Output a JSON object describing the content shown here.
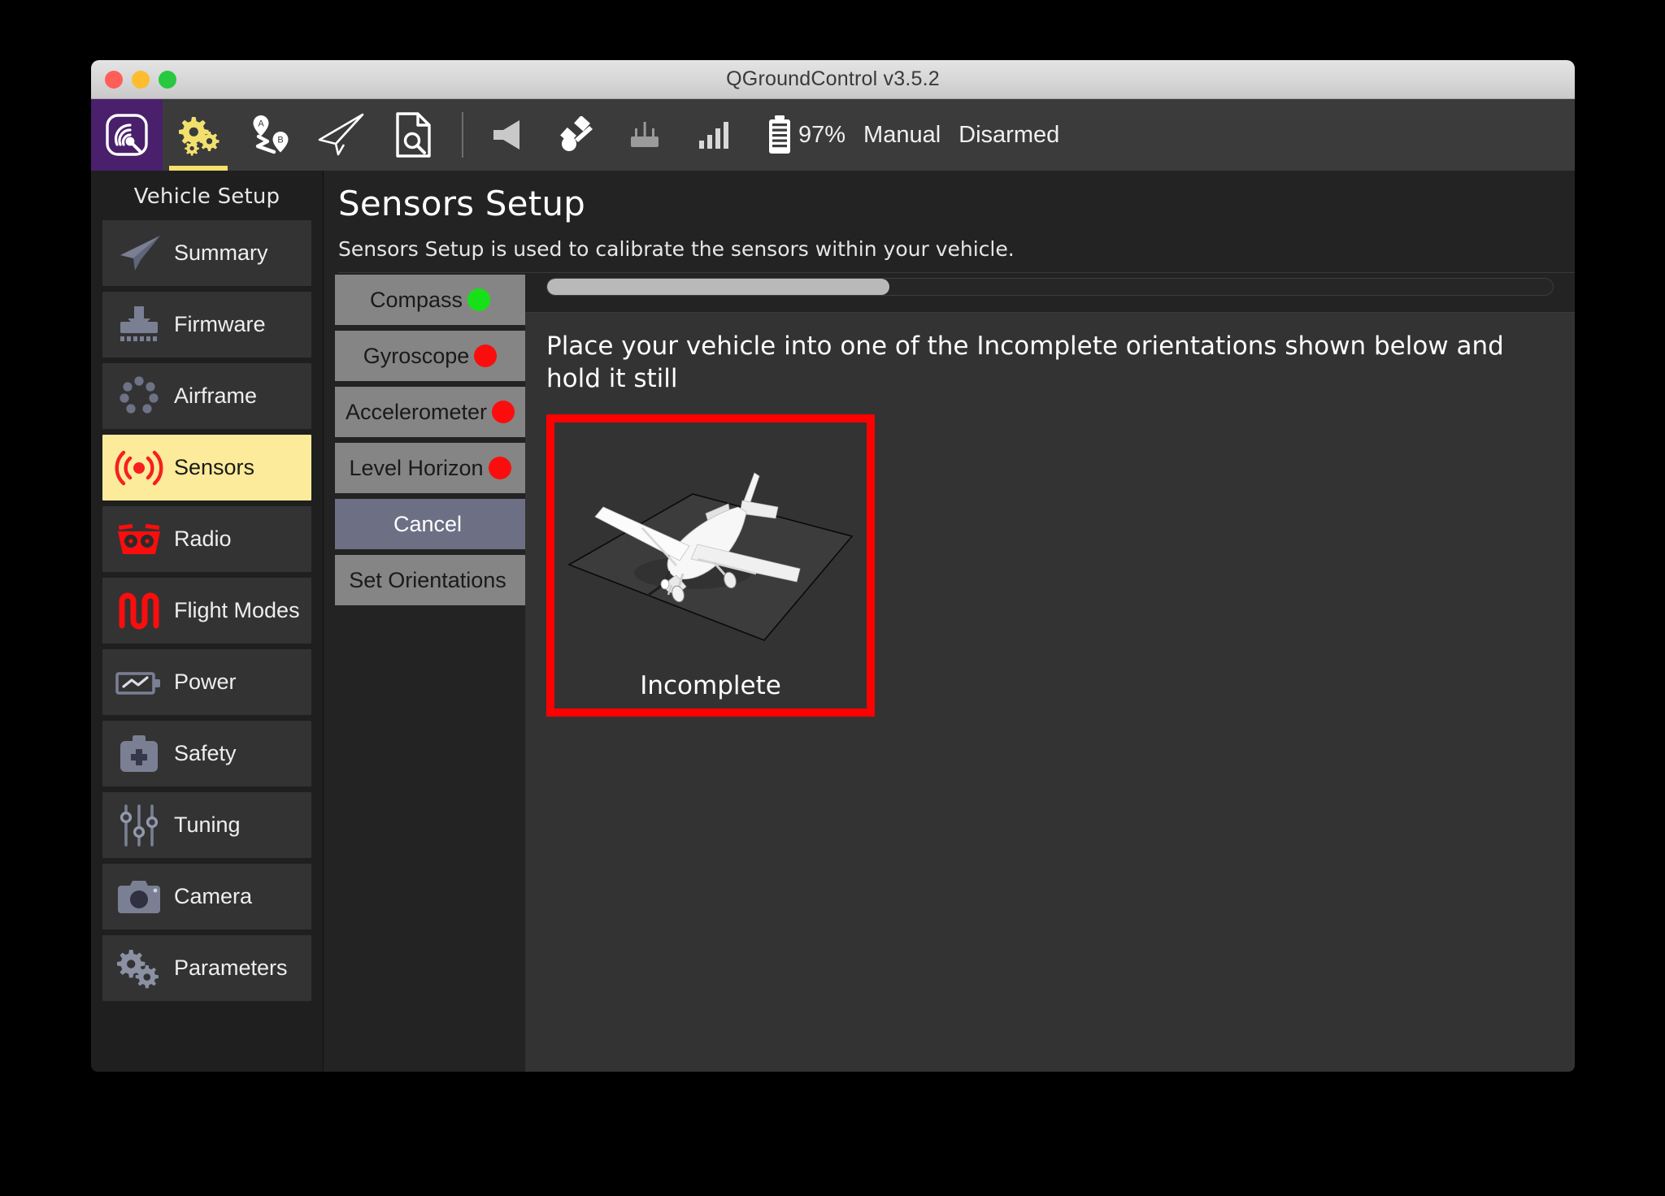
{
  "window": {
    "title": "QGroundControl v3.5.2",
    "traffic_lights": [
      "close",
      "minimize",
      "zoom"
    ]
  },
  "toolbar": {
    "app_button_icon": "qgc-logo-icon",
    "tabs": [
      {
        "icon": "gears-icon",
        "name": "vehicle-setup",
        "active": true
      },
      {
        "icon": "plan-route-icon",
        "name": "plan",
        "active": false
      },
      {
        "icon": "paper-plane-icon",
        "name": "fly",
        "active": false
      },
      {
        "icon": "analyze-file-icon",
        "name": "analyze",
        "active": false
      }
    ],
    "indicators": [
      {
        "icon": "megaphone-icon",
        "name": "messages-indicator"
      },
      {
        "icon": "satellite-icon",
        "name": "gps-indicator"
      },
      {
        "icon": "rc-controller-icon",
        "name": "rc-indicator"
      },
      {
        "icon": "signal-bars-icon",
        "name": "telemetry-indicator"
      }
    ],
    "battery_icon": "battery-icon",
    "battery_percent": "97%",
    "flight_mode": "Manual",
    "armed_state": "Disarmed"
  },
  "sidebar": {
    "title": "Vehicle Setup",
    "items": [
      {
        "label": "Summary",
        "icon": "paper-plane-icon",
        "selected": false
      },
      {
        "label": "Firmware",
        "icon": "firmware-download-icon",
        "selected": false
      },
      {
        "label": "Airframe",
        "icon": "airframe-dots-icon",
        "selected": false
      },
      {
        "label": "Sensors",
        "icon": "sensors-waves-icon",
        "selected": true
      },
      {
        "label": "Radio",
        "icon": "radio-controller-icon",
        "selected": false
      },
      {
        "label": "Flight Modes",
        "icon": "flight-modes-icon",
        "selected": false
      },
      {
        "label": "Power",
        "icon": "power-battery-icon",
        "selected": false
      },
      {
        "label": "Safety",
        "icon": "safety-kit-icon",
        "selected": false
      },
      {
        "label": "Tuning",
        "icon": "tuning-sliders-icon",
        "selected": false
      },
      {
        "label": "Camera",
        "icon": "camera-icon",
        "selected": false
      },
      {
        "label": "Parameters",
        "icon": "parameters-gears-icon",
        "selected": false
      }
    ]
  },
  "page": {
    "title": "Sensors Setup",
    "subtitle": "Sensors Setup is used to calibrate the sensors within your vehicle."
  },
  "calibration": {
    "buttons": [
      {
        "label": "Compass",
        "status": "ok",
        "type": "sensor"
      },
      {
        "label": "Gyroscope",
        "status": "bad",
        "type": "sensor"
      },
      {
        "label": "Accelerometer",
        "status": "bad",
        "type": "sensor"
      },
      {
        "label": "Level Horizon",
        "status": "bad",
        "type": "sensor"
      }
    ],
    "cancel_label": "Cancel",
    "set_orientations_label": "Set Orientations",
    "progress_percent": 34,
    "status_colors": {
      "ok": "#18e018",
      "bad": "#fb0d0d"
    }
  },
  "instructions": {
    "text": "Place your vehicle into one of the Incomplete orientations shown below and hold it still"
  },
  "orientation_card": {
    "label": "Incomplete",
    "highlight_color": "#ff0000",
    "vehicle_icon": "airplane-3d-icon"
  }
}
